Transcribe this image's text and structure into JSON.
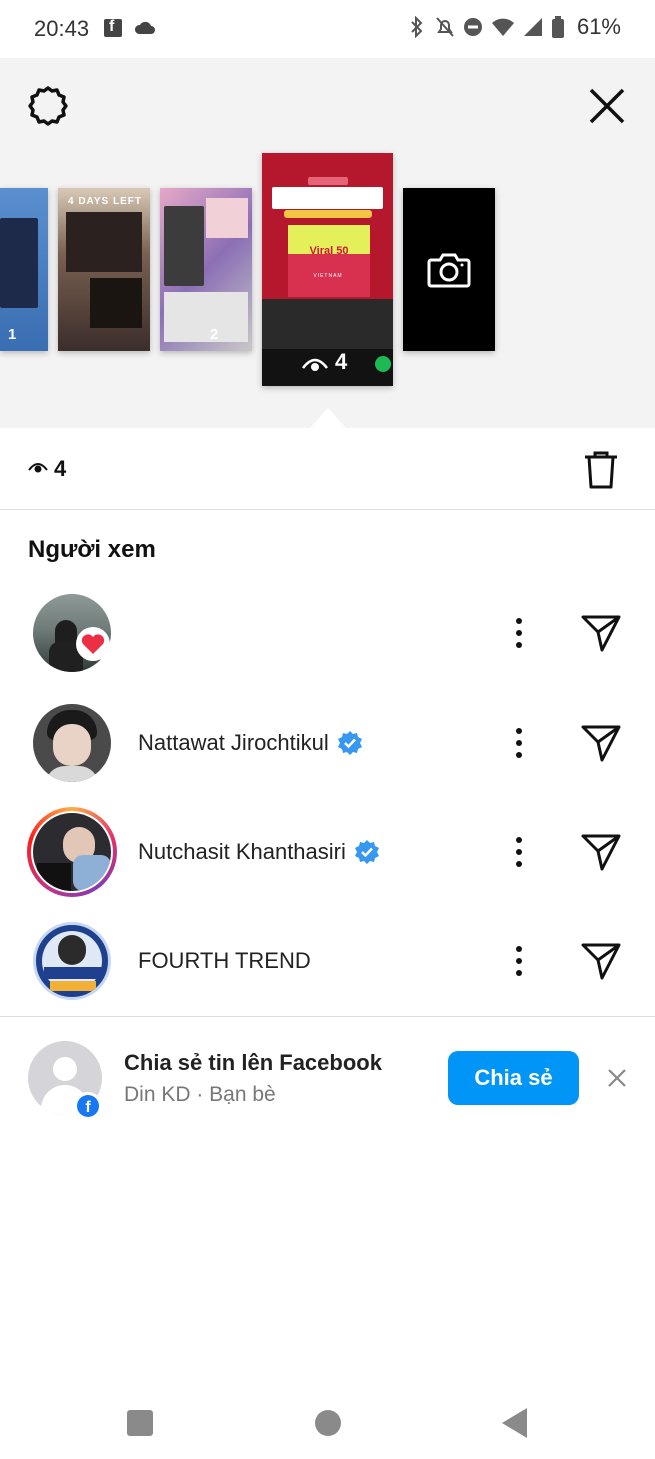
{
  "status_bar": {
    "time": "20:43",
    "battery": "61%"
  },
  "story_strip": {
    "thumbs": [
      {
        "count": "1"
      },
      {
        "title": "4 DAYS LEFT"
      },
      {
        "count": "2"
      },
      {
        "count": "4",
        "label": "Viral 50",
        "sublabel": "VIETNAM"
      }
    ]
  },
  "views": {
    "count": "4"
  },
  "viewers": {
    "title": "Người xem",
    "items": [
      {
        "name": "",
        "verified": false,
        "liked": true
      },
      {
        "name": "Nattawat Jirochtikul",
        "verified": true,
        "liked": false
      },
      {
        "name": "Nutchasit Khanthasiri",
        "verified": true,
        "liked": false
      },
      {
        "name": "FOURTH TREND",
        "verified": false,
        "liked": false
      }
    ]
  },
  "facebook_share": {
    "title": "Chia sẻ tin lên Facebook",
    "subtitle": "Din KD · Bạn bè",
    "button_label": "Chia sẻ"
  },
  "colors": {
    "accent": "#0095f6",
    "verified": "#3897f0",
    "heart": "#ed2f45",
    "facebook": "#1877f2"
  },
  "icons": [
    "settings-icon",
    "close-icon",
    "camera-icon",
    "eye-icon",
    "trash-icon",
    "more-icon",
    "send-icon",
    "verified-icon",
    "heart-icon",
    "facebook-icon"
  ]
}
